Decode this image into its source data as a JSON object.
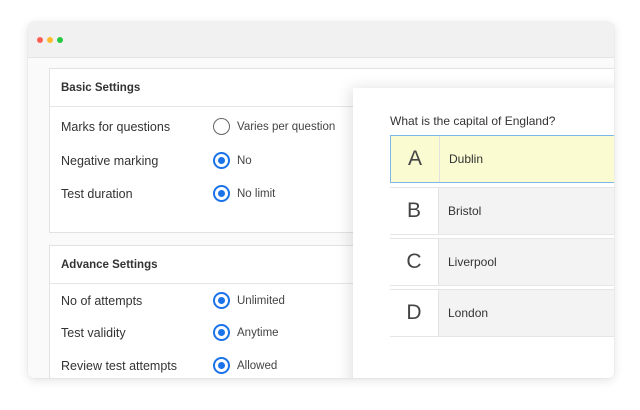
{
  "window": {
    "controls": [
      "close",
      "minimize",
      "maximize"
    ]
  },
  "basic_settings": {
    "title": "Basic Settings",
    "rows": [
      {
        "label": "Marks for questions",
        "value": "Varies per question",
        "selected": false
      },
      {
        "label": "Negative marking",
        "value": "No",
        "selected": true
      },
      {
        "label": "Test duration",
        "value": "No limit",
        "selected": true
      }
    ]
  },
  "advance_settings": {
    "title": "Advance Settings",
    "rows": [
      {
        "label": "No of attempts",
        "value": "Unlimited",
        "selected": true
      },
      {
        "label": "Test validity",
        "value": "Anytime",
        "selected": true
      },
      {
        "label": "Review test attempts",
        "value": "Allowed",
        "selected": true
      }
    ]
  },
  "quiz": {
    "question": "What is the capital of England?",
    "options": [
      {
        "letter": "A",
        "text": "Dublin",
        "highlighted": true
      },
      {
        "letter": "B",
        "text": "Bristol",
        "highlighted": false
      },
      {
        "letter": "C",
        "text": "Liverpool",
        "highlighted": false
      },
      {
        "letter": "D",
        "text": "London",
        "highlighted": false
      }
    ]
  },
  "colors": {
    "accent": "#1a73e8",
    "highlight": "#fafbd0",
    "highlight_border": "#7bb6e6"
  }
}
